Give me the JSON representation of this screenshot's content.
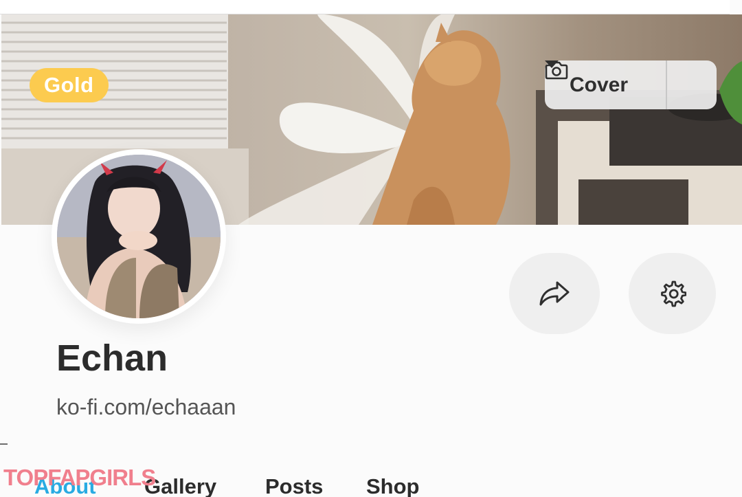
{
  "cover": {
    "tier_badge": "Gold",
    "button_label": "Cover",
    "camera_icon": "camera-icon",
    "dropdown_icon": "caret-down-icon"
  },
  "profile": {
    "name": "Echan",
    "url": "ko-fi.com/echaaan"
  },
  "actions": {
    "share_icon": "share-icon",
    "settings_icon": "gear-icon"
  },
  "tabs": [
    {
      "label": "About",
      "active": true
    },
    {
      "label": "Gallery",
      "active": false
    },
    {
      "label": "Posts",
      "active": false
    },
    {
      "label": "Shop",
      "active": false
    }
  ],
  "watermark": "TOPFAPGIRLS",
  "colors": {
    "gold": "#fccb4f",
    "accent": "#29abe2",
    "button_bg": "#efefef",
    "text": "#2c2c2c"
  }
}
